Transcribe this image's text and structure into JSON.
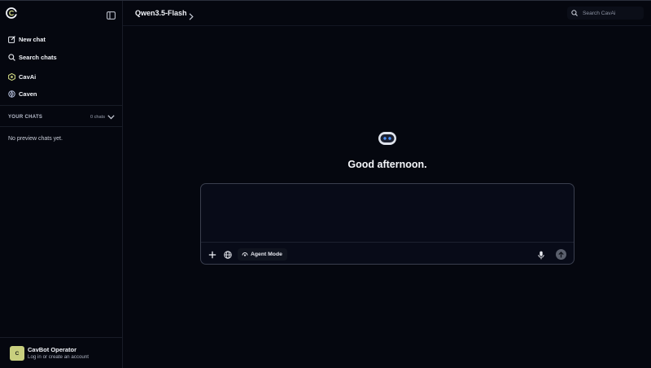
{
  "sidebar": {
    "items": [
      {
        "label": "New chat",
        "icon": "new-chat-icon"
      },
      {
        "label": "Search chats",
        "icon": "search-icon"
      },
      {
        "label": "CavAi",
        "icon": "cavai-icon"
      },
      {
        "label": "Caven",
        "icon": "caven-icon"
      }
    ],
    "section": {
      "title": "YOUR CHATS",
      "count": "0 chats"
    },
    "empty_text": "No preview chats yet.",
    "account": {
      "initial": "C",
      "name": "CavBot Operator",
      "subtitle": "Log in or create an account"
    }
  },
  "header": {
    "model": "Qwen3.5-Flash",
    "search_placeholder": "Search CavAi"
  },
  "main": {
    "greeting": "Good afternoon.",
    "composer": {
      "agent_mode_label": "Agent Mode"
    }
  },
  "colors": {
    "background": "#05070f",
    "accent_cavai": "#c8cf7e",
    "avatar": "#c8cf7e",
    "bot_eyes": "#4a8fff"
  }
}
